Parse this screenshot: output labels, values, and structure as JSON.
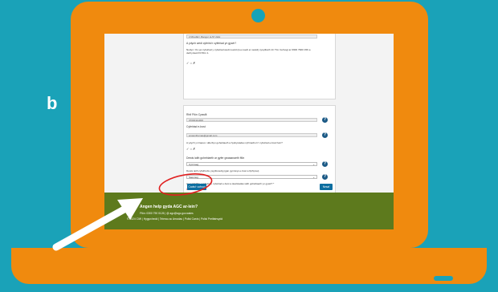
{
  "side_letter": "b",
  "card1": {
    "address_value": "2 Rhodfa'r, Bangor LL57 2HH",
    "question_label": "A ydych wedi cyfeirio'r cyfeiriad yn gywir?",
    "body_text": "Nodyn: Os yw cyfeiriad y cyfeiriad wedi newid (neu wedi ei newid) cysylltwch â'r Tîm Cefnogi ar 0300 7900 156 a derbyniad rhif ffôn 1.",
    "radio_text": "✓ ○ ✗"
  },
  "card2": {
    "phone_label": "Rhif Ffôn Cyswllt",
    "phone_value": "07000111000",
    "email_label": "Cyfeiriad e-bost",
    "email_value": "enwenthomas@gmail.com",
    "email_question": "A ydych yn hapus i dderbyn gohebiaeth a hysbysiadau cyfrinachol i'r cyfeiriad e-bost hwn?",
    "radio_text": "✓ ○ ✗",
    "language_label": "Dewis iaith gohebiaeth ar gyfer gwasanaeth ffôn",
    "language_value": "Cymraeg",
    "format_label": "Dewis iaith cyfathrebu ysgrifenedig (gan gynnwys e-bost a llythyrau)",
    "format_value": "Saesneg",
    "confirm_label": "A yw rhif ffôn y cyfeiriad, cyfeiriad e-bost a dewisiadau iaith gohebiaeth yn gywir? *",
    "confirm_radio": "● ✓ ✗"
  },
  "buttons": {
    "save": "Cadw'r cofnod",
    "next": "Nesaf"
  },
  "footer": {
    "help_title": "Angen help gyda AGC ar-lein?",
    "contact": "Ffôn: 0300 790 0126  |  @ agc@agc.gov.wales",
    "links": "© 2024 CIW  |  Hygyrchedd  |  Telerau ac Amodau  |  Polisi Cwcis  |  Polisi Preifatrwydd"
  },
  "colors": {
    "laptop": "#f08a0e",
    "background": "#1aa2b8",
    "footer": "#5d7a1d",
    "button": "#0d6ea0",
    "annotation": "#e02020"
  }
}
